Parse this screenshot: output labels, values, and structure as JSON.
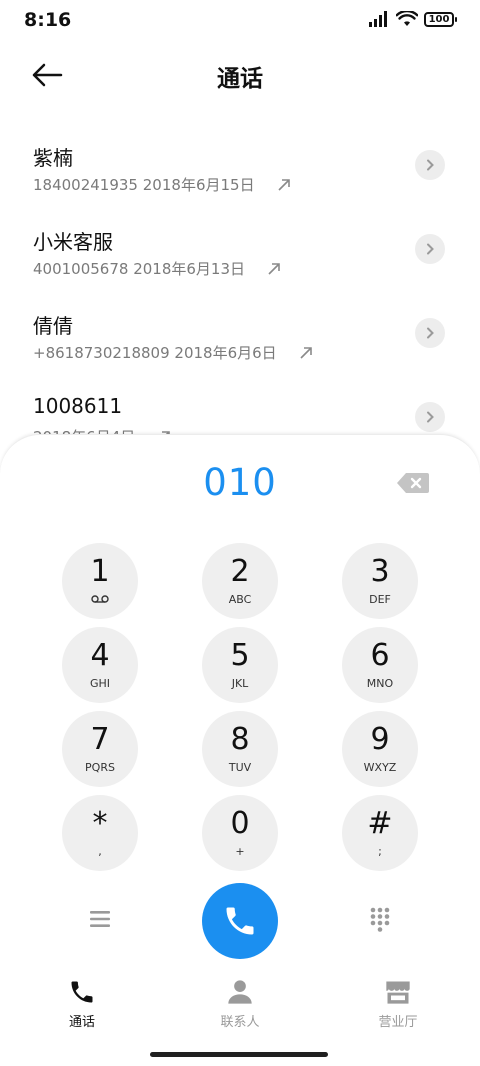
{
  "status_bar": {
    "time": "8:16",
    "battery": "100"
  },
  "header": {
    "title": "通话"
  },
  "calls": [
    {
      "name": "紫楠",
      "number": "18400241935",
      "date": "2018年6月15日"
    },
    {
      "name": "小米客服",
      "number": "4001005678",
      "date": "2018年6月13日"
    },
    {
      "name": "倩倩",
      "number": "+8618730218809",
      "date": "2018年6月6日"
    },
    {
      "name": "1008611",
      "number": "",
      "date": "2018年6月4日"
    }
  ],
  "dialpad": {
    "entered": "010",
    "keys": [
      {
        "digit": "1",
        "letters": ""
      },
      {
        "digit": "2",
        "letters": "ABC"
      },
      {
        "digit": "3",
        "letters": "DEF"
      },
      {
        "digit": "4",
        "letters": "GHI"
      },
      {
        "digit": "5",
        "letters": "JKL"
      },
      {
        "digit": "6",
        "letters": "MNO"
      },
      {
        "digit": "7",
        "letters": "PQRS"
      },
      {
        "digit": "8",
        "letters": "TUV"
      },
      {
        "digit": "9",
        "letters": "WXYZ"
      },
      {
        "digit": "*",
        "letters": ","
      },
      {
        "digit": "0",
        "letters": "+"
      },
      {
        "digit": "#",
        "letters": ";"
      }
    ]
  },
  "tabs": [
    {
      "label": "通话",
      "icon": "phone-icon",
      "active": true
    },
    {
      "label": "联系人",
      "icon": "person-icon",
      "active": false
    },
    {
      "label": "营业厅",
      "icon": "store-icon",
      "active": false
    }
  ],
  "colors": {
    "accent": "#1b8ff0",
    "key_bg": "#efefef",
    "meta_text": "#7a7a7a",
    "inactive_tab": "#9a9a9a"
  }
}
